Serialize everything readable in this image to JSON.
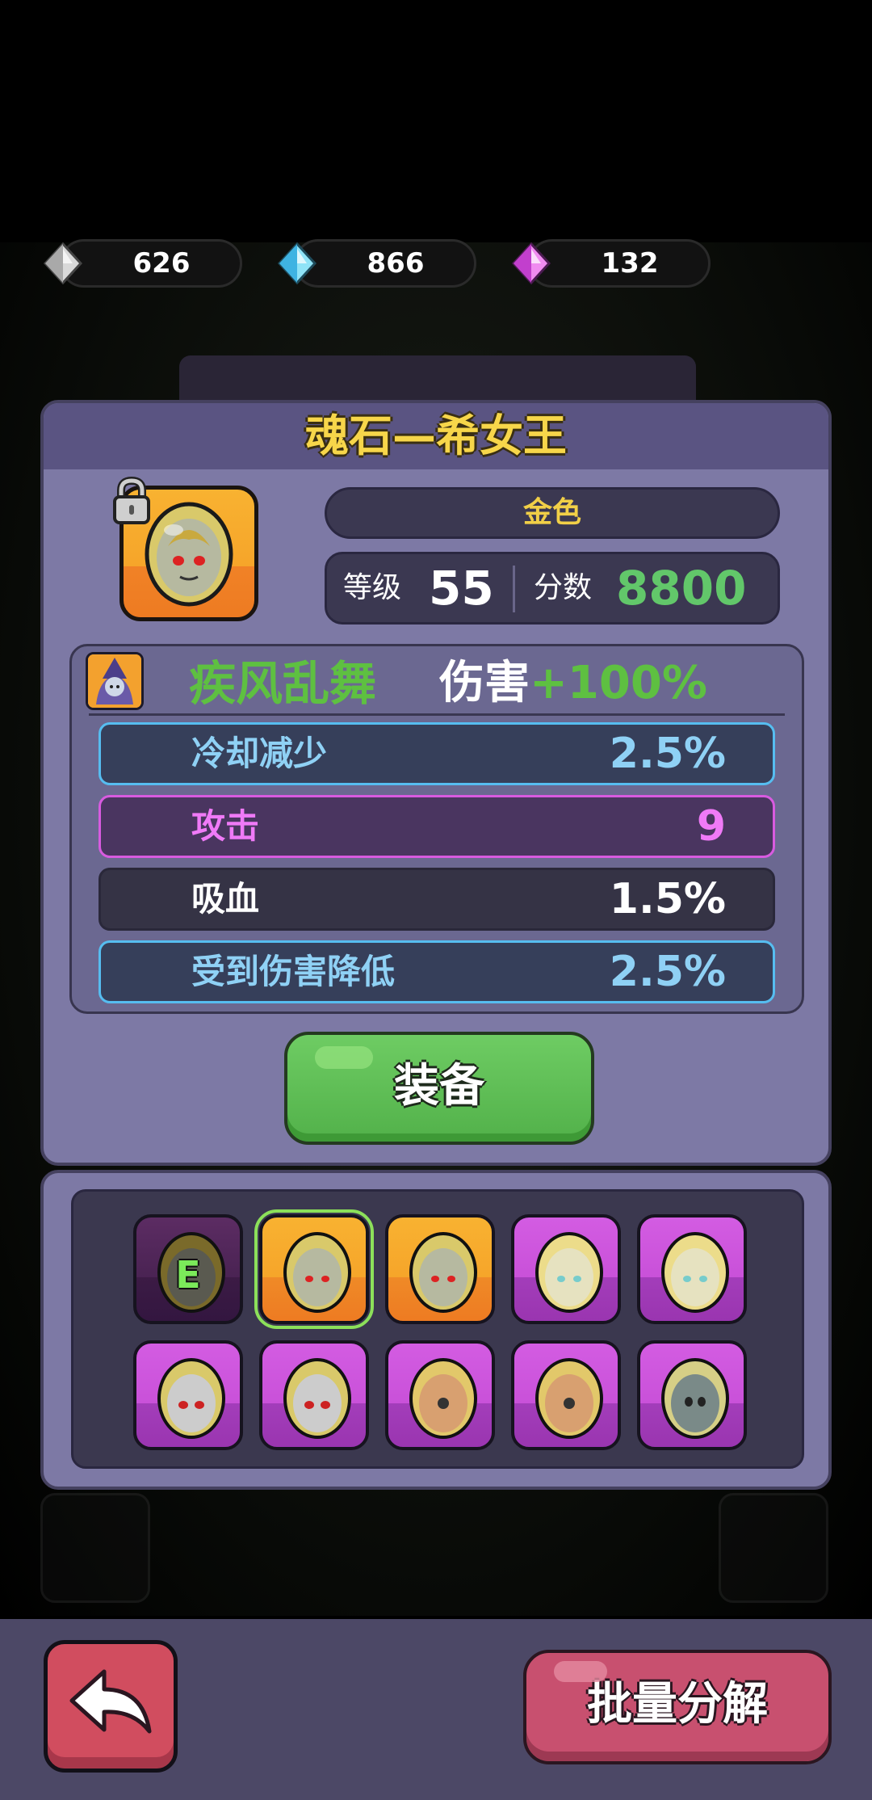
{
  "currencies": [
    {
      "icon": "silver-diamond-icon",
      "value": "626"
    },
    {
      "icon": "blue-diamond-icon",
      "value": "866"
    },
    {
      "icon": "purple-diamond-icon",
      "value": "132"
    }
  ],
  "item": {
    "title": "魂石—希女王",
    "rarity": "金色",
    "level_label": "等级",
    "level": "55",
    "score_label": "分数",
    "score": "8800",
    "locked": true
  },
  "skill": {
    "name": "疾风乱舞",
    "effect_label": "伤害",
    "effect_value": "+100%"
  },
  "attributes": [
    {
      "name": "冷却减少",
      "value": "2.5%",
      "style": "blue"
    },
    {
      "name": "攻击",
      "value": "9",
      "style": "purple"
    },
    {
      "name": "吸血",
      "value": "1.5%",
      "style": "dark"
    },
    {
      "name": "受到伤害降低",
      "value": "2.5%",
      "style": "blue"
    }
  ],
  "equip_button": "装备",
  "inventory": {
    "equipped_badge": "E"
  },
  "batch_button": "批量分解",
  "colors": {
    "gold_title": "#f7d64a",
    "green": "#5ec041",
    "blue_row": "#56bdf0",
    "purple_row": "#d85be0"
  }
}
